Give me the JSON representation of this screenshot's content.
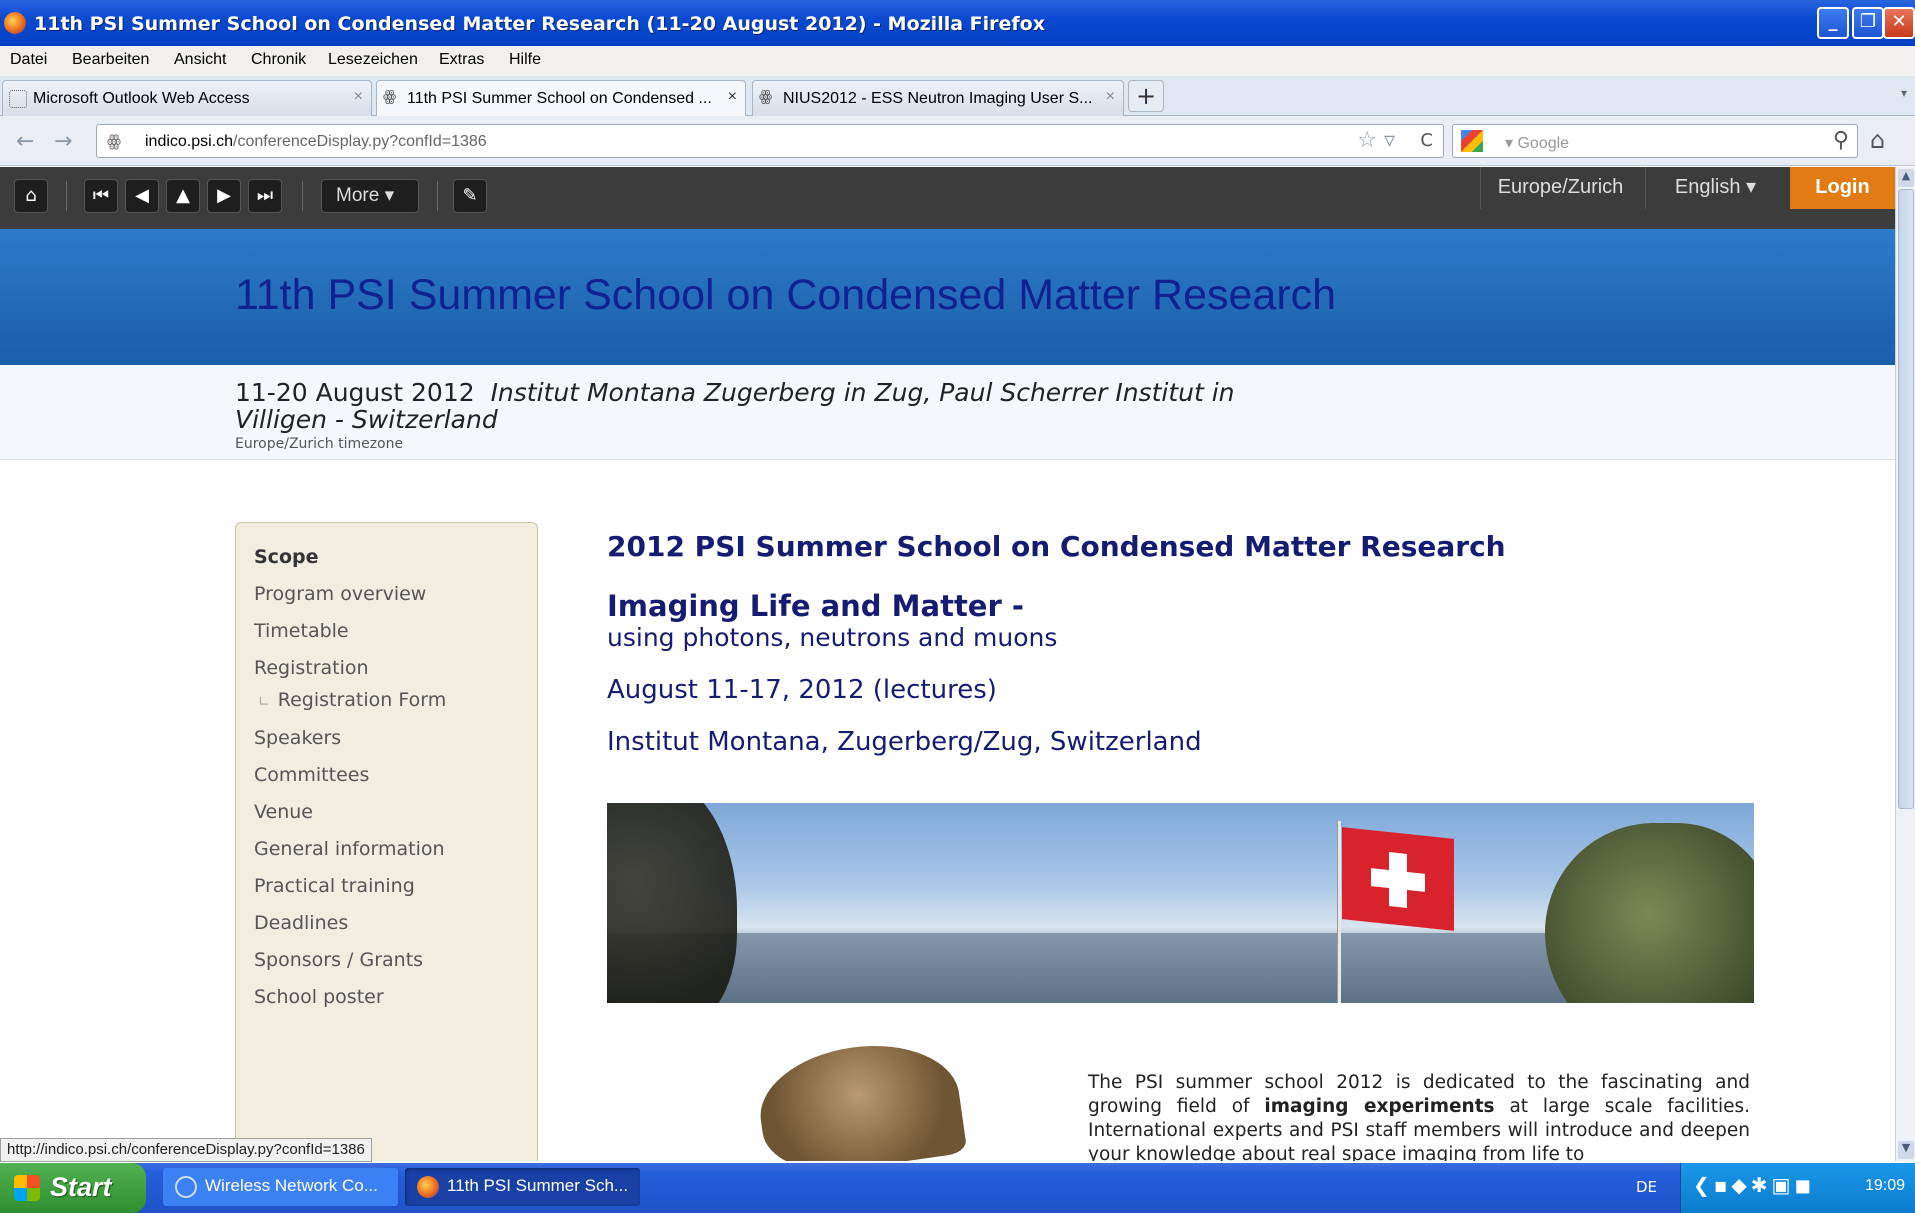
{
  "window": {
    "title": "11th PSI Summer School on Condensed Matter Research (11-20 August 2012) - Mozilla Firefox",
    "min": "_",
    "max": "❐",
    "close": "✕"
  },
  "menu": [
    "Datei",
    "Bearbeiten",
    "Ansicht",
    "Chronik",
    "Lesezeichen",
    "Extras",
    "Hilfe"
  ],
  "tabs": [
    {
      "label": "Microsoft Outlook Web Access",
      "close": "×"
    },
    {
      "label": "11th PSI Summer School on Condensed ...",
      "close": "×"
    },
    {
      "label": "NIUS2012 - ESS Neutron Imaging User S...",
      "close": "×"
    }
  ],
  "tab_icons": {
    "mask": "ꙮ"
  },
  "newtab": "+",
  "tablist": "▾",
  "nav": {
    "back": "←",
    "forward": "→",
    "url_domain": "indico.psi.ch",
    "url_path": "/conferenceDisplay.py?confId=1386",
    "site_icon": "ꙮ",
    "star": "☆ ▿",
    "reload": "C",
    "search_placeholder": "▾ Google",
    "search_icon": "⚲",
    "home": "⌂"
  },
  "indico_bar": {
    "home": "⌂",
    "first": "⏮",
    "prev": "◀",
    "up": "▲",
    "next": "▶",
    "last": "⏭",
    "more": "More ▾",
    "edit": "✎",
    "timezone": "Europe/Zurich",
    "language": "English ▾",
    "login": "Login"
  },
  "conference": {
    "title": "11th PSI Summer School on Condensed Matter Research",
    "dates": "11-20 August 2012",
    "venue": "Institut Montana Zugerberg in Zug, Paul Scherrer Institut in Villigen - Switzerland",
    "timezone_note": "Europe/Zurich timezone"
  },
  "sidebar": {
    "items": [
      {
        "label": "Scope",
        "active": true
      },
      {
        "label": "Program overview"
      },
      {
        "label": "Timetable"
      },
      {
        "label": "Registration"
      },
      {
        "label": "Registration Form",
        "sub": true
      },
      {
        "label": "Speakers"
      },
      {
        "label": "Committees"
      },
      {
        "label": "Venue"
      },
      {
        "label": "General information"
      },
      {
        "label": "Practical training"
      },
      {
        "label": "Deadlines"
      },
      {
        "label": "Sponsors / Grants"
      },
      {
        "label": "School poster"
      }
    ],
    "branch": "∟"
  },
  "content": {
    "heading": "2012 PSI Summer School on Condensed Matter Research",
    "subheading": "Imaging Life and Matter -",
    "subheading2": "using photons, neutrons and muons",
    "lecture_dates": "August 11-17, 2012 (lectures)",
    "location": "Institut Montana, Zugerberg/Zug, Switzerland",
    "body_prefix": "The PSI summer school 2012 is dedicated to the fascinating and growing field of ",
    "body_bold": "imaging experiments",
    "body_suffix": " at large scale facilities. International experts and PSI staff members will introduce and deepen your knowledge about real space imaging from life to"
  },
  "statusbar": {
    "url": "http://indico.psi.ch/conferenceDisplay.py?confId=1386"
  },
  "taskbar": {
    "start": "Start",
    "tasks": [
      {
        "label": "Wireless Network Co..."
      },
      {
        "label": "11th PSI Summer Sch..."
      }
    ],
    "tray_lang": "DE",
    "tray_icons": "❮▪◆✱▣◼",
    "clock": "19:09"
  },
  "scrollbar": {
    "up": "▲",
    "down": "▼"
  }
}
